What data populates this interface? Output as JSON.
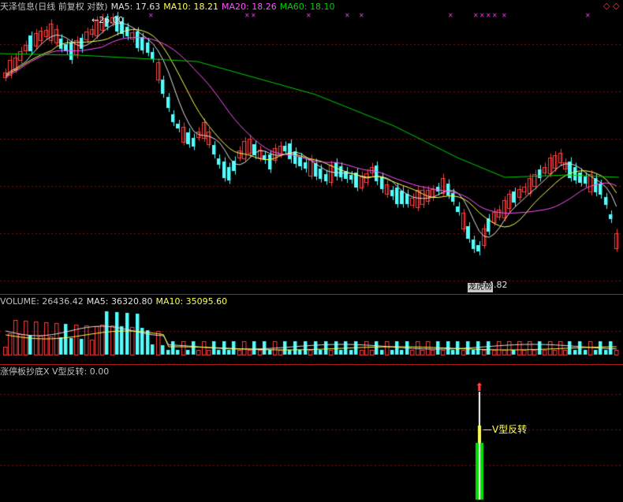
{
  "header": {
    "title": "天泽信息(日线 前复权 对数)",
    "ma5": "MA5: 17.63",
    "ma10": "MA10: 18.21",
    "ma20": "MA20: 18.26",
    "ma60": "MA60: 18.10"
  },
  "volume_header": {
    "volume": "VOLUME: 26436.42",
    "ma5": "MA5: 36320.80",
    "ma10": "MA10: 35095.60"
  },
  "indicator_header": {
    "name": "涨停板抄底X V型反转: 0.00"
  },
  "annotations": {
    "high_price": "26.00",
    "low_price": "14.82",
    "low_tag": "龙虎榜",
    "signal_label": "V型反转"
  },
  "corner_icons": [
    "restore-icon",
    "close-icon"
  ],
  "colors": {
    "up": "#ff3d3d",
    "down": "#54fcfc",
    "ma5": "#e0e0e0",
    "ma10": "#ffff54",
    "ma20": "#ff54ff",
    "ma60": "#00d000",
    "signal": "#00e000"
  }
}
